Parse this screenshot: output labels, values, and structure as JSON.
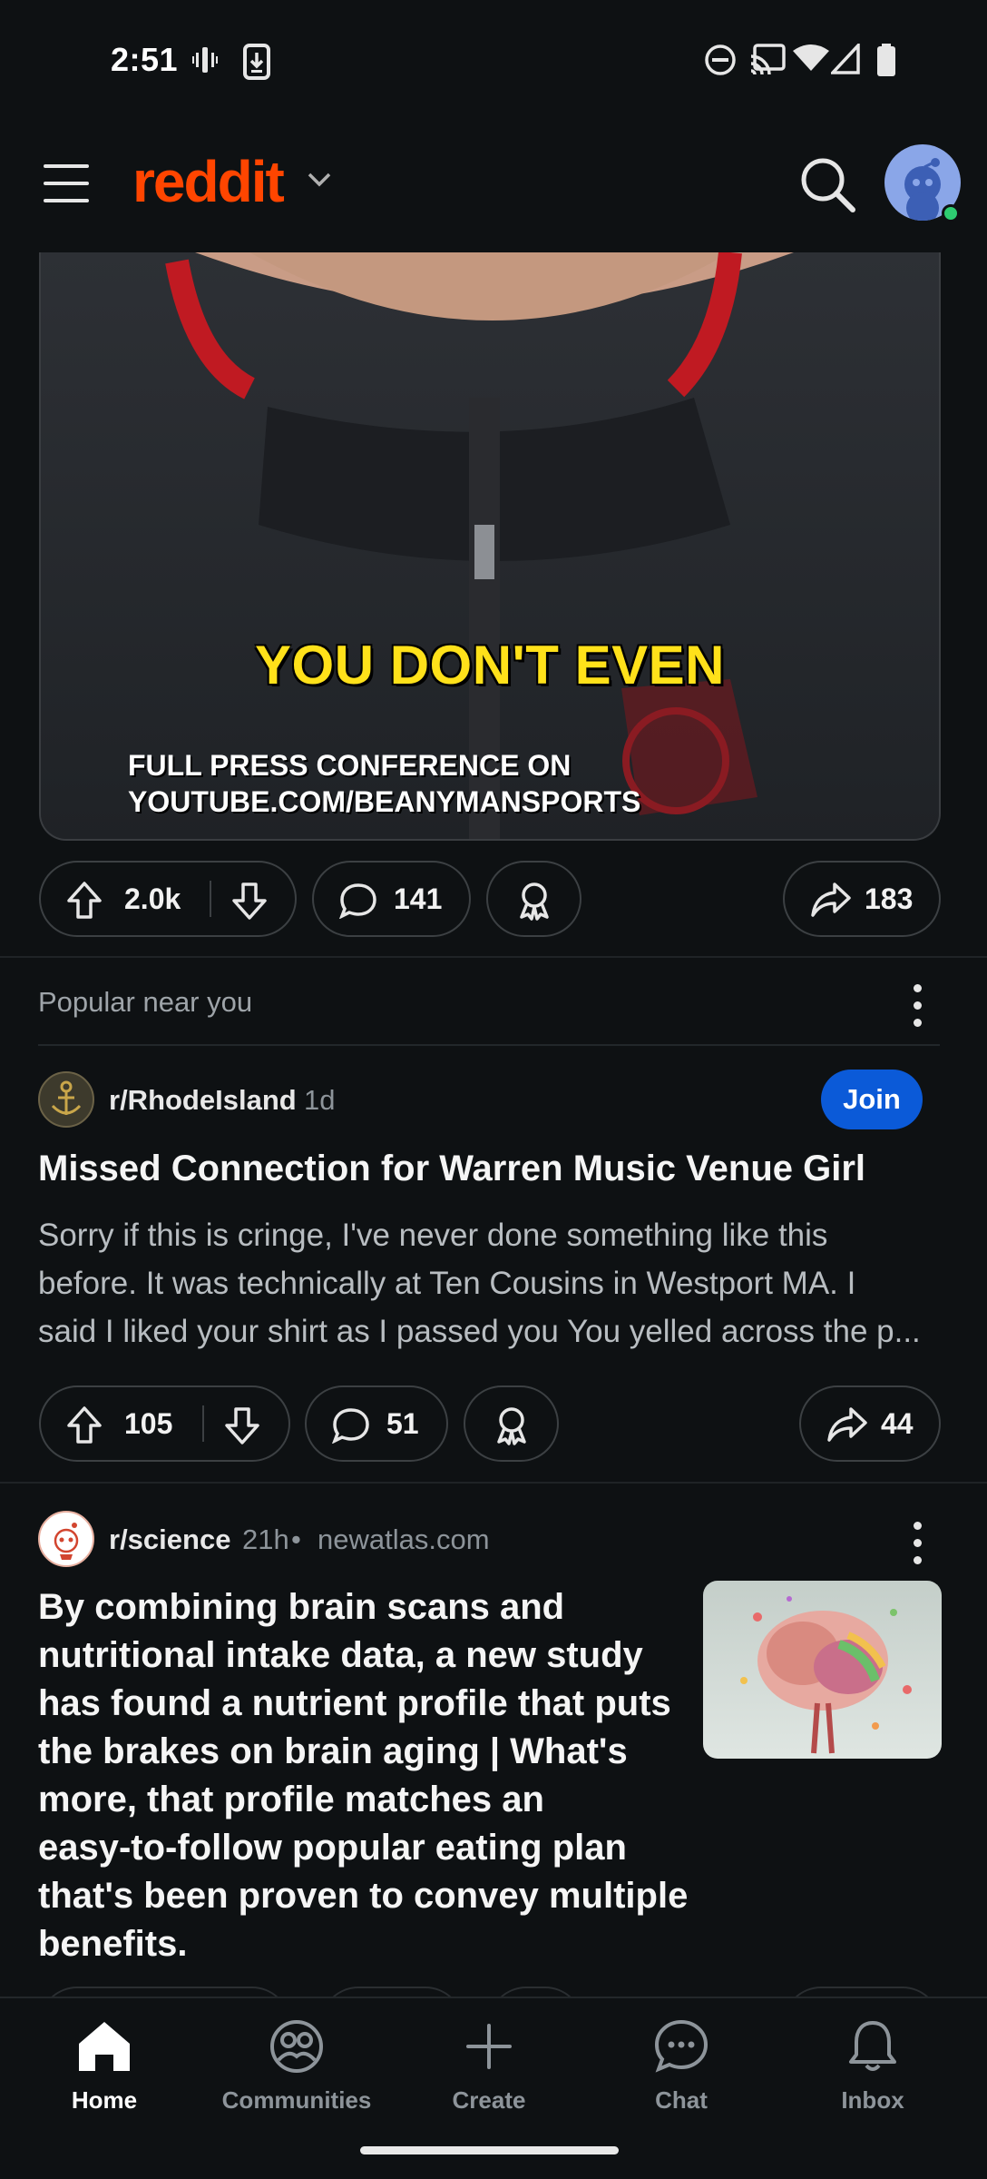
{
  "status_bar": {
    "time": "2:51"
  },
  "header": {
    "logo": "reddit",
    "search_icon": "search-icon",
    "avatar_icon": "snoo-avatar-icon"
  },
  "video_post": {
    "caption_main": "YOU DON'T EVEN",
    "caption_line1": "FULL PRESS CONFERENCE ON",
    "caption_line2": "YOUTUBE.COM/BEANYMANSPORTS",
    "upvotes": "2.0k",
    "comments": "141",
    "shares": "183"
  },
  "feed_section": {
    "label": "Popular near you"
  },
  "post1": {
    "subreddit": "r/RhodeIsland",
    "age": "1d",
    "join_label": "Join",
    "title": "Missed Connection for Warren Music Venue Girl",
    "body_lines": [
      "Sorry if this is cringe, I've never done something like this",
      "before. It was technically at Ten Cousins in Westport MA. I",
      "said I liked your shirt as I passed you You yelled across the p..."
    ],
    "upvotes": "105",
    "comments": "51",
    "shares": "44"
  },
  "post2": {
    "subreddit": "r/science",
    "age": "21h",
    "domain": "newatlas.com",
    "title_lines": [
      "By combining brain scans and",
      "nutritional intake data, a new study",
      "has found a nutrient profile that puts",
      "the brakes on brain aging | What's",
      "more, that profile matches an",
      "easy-to-follow popular eating plan",
      "that's been proven to convey multiple",
      "benefits."
    ]
  },
  "bottom_nav": {
    "items": [
      {
        "label": "Home",
        "icon": "home-icon",
        "active": true
      },
      {
        "label": "Communities",
        "icon": "communities-icon",
        "active": false
      },
      {
        "label": "Create",
        "icon": "plus-icon",
        "active": false
      },
      {
        "label": "Chat",
        "icon": "chat-icon",
        "active": false
      },
      {
        "label": "Inbox",
        "icon": "bell-icon",
        "active": false
      }
    ]
  },
  "colors": {
    "background": "#0e1113",
    "brand": "#ff4500",
    "join": "#0b5ad8",
    "caption": "#ffe11a"
  }
}
